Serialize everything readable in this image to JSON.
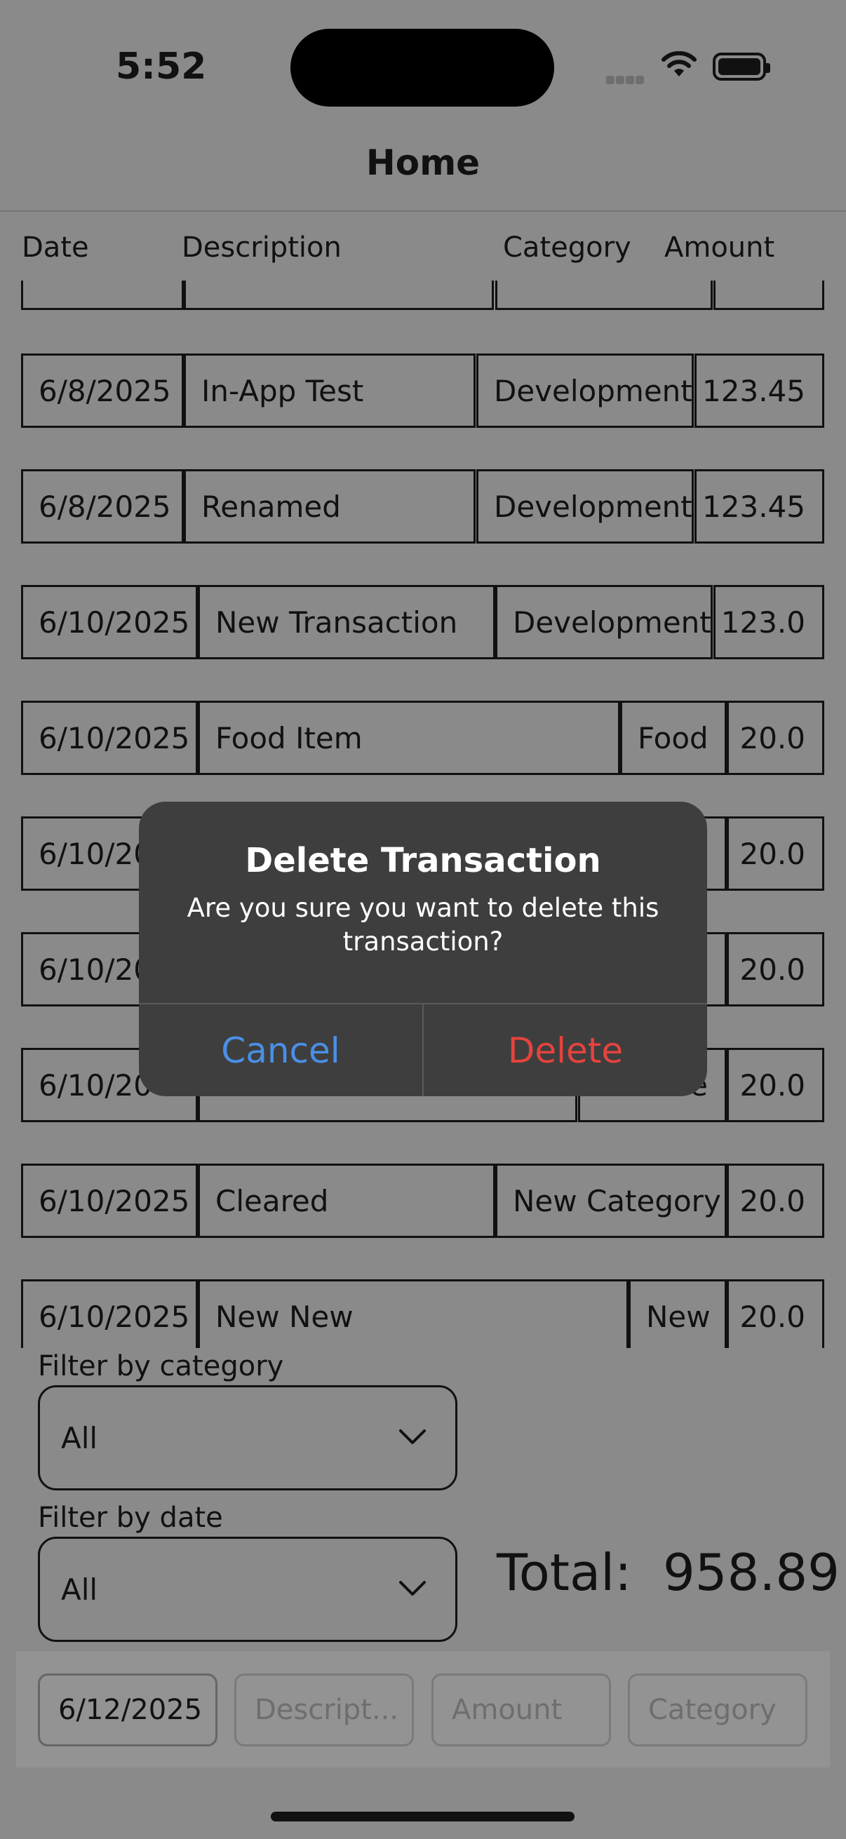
{
  "status_bar": {
    "time": "5:52"
  },
  "nav": {
    "title": "Home"
  },
  "columns": {
    "date": "Date",
    "description": "Description",
    "category": "Category",
    "amount": "Amount"
  },
  "transactions": [
    {
      "date": "",
      "description": "",
      "category": "",
      "amount": ""
    },
    {
      "date": "6/8/2025",
      "description": "In-App Test",
      "category": "Development",
      "amount": "123.45"
    },
    {
      "date": "6/8/2025",
      "description": "Renamed",
      "category": "Development",
      "amount": "123.45"
    },
    {
      "date": "6/10/2025",
      "description": "New Transaction",
      "category": "Development",
      "amount": "123.0"
    },
    {
      "date": "6/10/2025",
      "description": "Food Item",
      "category": "Food",
      "amount": "20.0"
    },
    {
      "date": "6/10/20",
      "description": "",
      "category": "",
      "amount": "20.0"
    },
    {
      "date": "6/10/20",
      "description": "",
      "category": "",
      "amount": "20.0"
    },
    {
      "date": "6/10/20",
      "description": "",
      "category": "e",
      "amount": "20.0"
    },
    {
      "date": "6/10/2025",
      "description": "Cleared",
      "category": "New Category",
      "amount": "20.0"
    },
    {
      "date": "6/10/2025",
      "description": "New New",
      "category": "New",
      "amount": "20.0"
    }
  ],
  "filters": {
    "category_label": "Filter by category",
    "category_value": "All",
    "date_label": "Filter by date",
    "date_value": "All"
  },
  "total": {
    "label": "Total:",
    "value": "958.89"
  },
  "new_entry": {
    "date_value": "6/12/2025",
    "description_placeholder": "Descript...",
    "amount_placeholder": "Amount",
    "category_placeholder": "Category"
  },
  "alert": {
    "title": "Delete Transaction",
    "message": "Are you sure you want to delete this transaction?",
    "cancel_label": "Cancel",
    "delete_label": "Delete"
  },
  "colors": {
    "cancel": "#4a8fe7",
    "delete": "#e5433d",
    "alert_bg": "#3e3e3e",
    "dim_bg": "#8a8a8a"
  }
}
